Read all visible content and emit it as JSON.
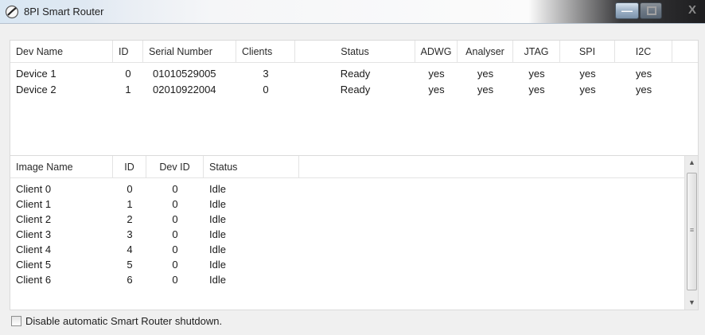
{
  "window": {
    "title": "8PI Smart Router"
  },
  "titlebar_controls": {
    "minimize": "—",
    "close": "X"
  },
  "devices": {
    "columns": [
      "Dev Name",
      "ID",
      "Serial Number",
      "Clients",
      "Status",
      "ADWG",
      "Analyser",
      "JTAG",
      "SPI",
      "I2C"
    ],
    "rows": [
      [
        "Device 1",
        "0",
        "01010529005",
        "3",
        "Ready",
        "yes",
        "yes",
        "yes",
        "yes",
        "yes"
      ],
      [
        "Device 2",
        "1",
        "02010922004",
        "0",
        "Ready",
        "yes",
        "yes",
        "yes",
        "yes",
        "yes"
      ]
    ]
  },
  "images": {
    "columns": [
      "Image Name",
      "ID",
      "Dev ID",
      "Status"
    ],
    "rows": [
      [
        "Client 0",
        "0",
        "0",
        "Idle"
      ],
      [
        "Client 1",
        "1",
        "0",
        "Idle"
      ],
      [
        "Client 2",
        "2",
        "0",
        "Idle"
      ],
      [
        "Client 3",
        "3",
        "0",
        "Idle"
      ],
      [
        "Client 4",
        "4",
        "0",
        "Idle"
      ],
      [
        "Client 5",
        "5",
        "0",
        "Idle"
      ],
      [
        "Client 6",
        "6",
        "0",
        "Idle"
      ]
    ]
  },
  "footer": {
    "checkbox_label": "Disable automatic Smart Router shutdown.",
    "checked": false
  }
}
